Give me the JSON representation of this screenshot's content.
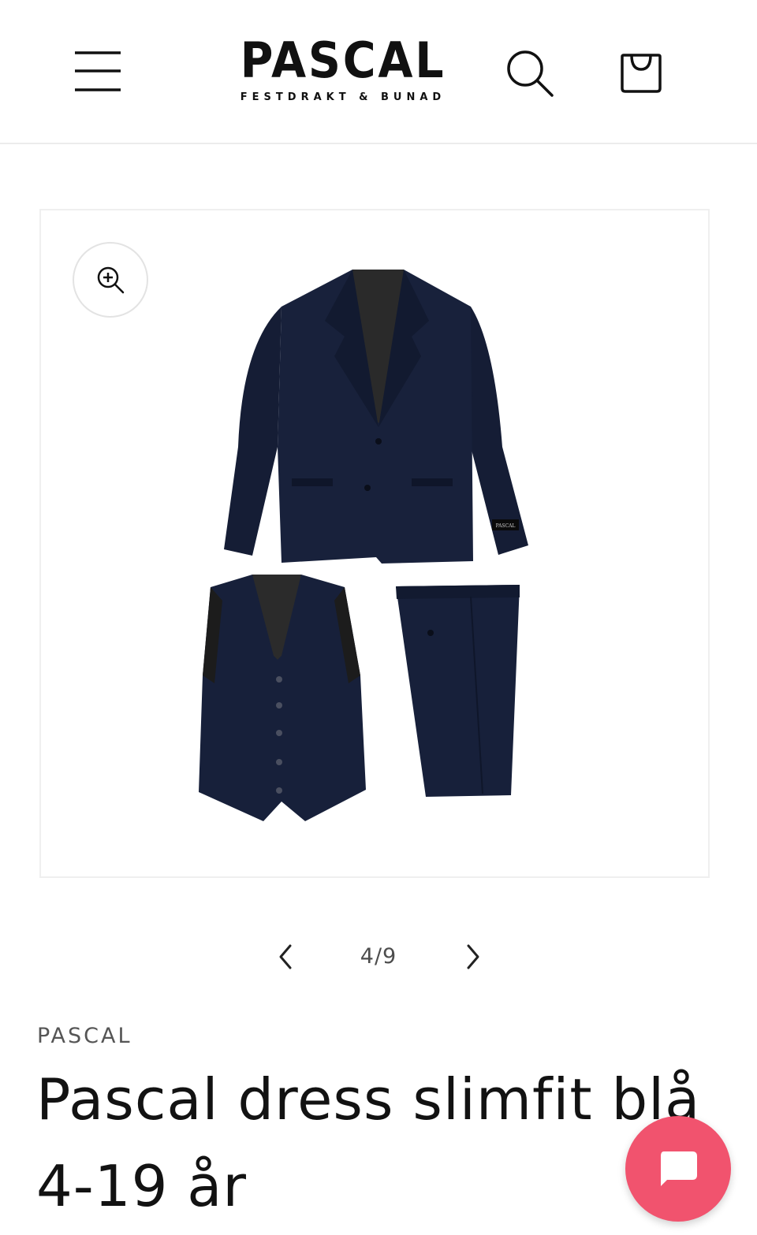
{
  "header": {
    "logo_main": "PASCAL",
    "logo_tagline": "FESTDRAKT & BUNAD",
    "menu_icon": "hamburger-menu-icon",
    "search_icon": "search-icon",
    "cart_icon": "shopping-bag-icon"
  },
  "gallery": {
    "zoom_icon": "zoom-in-icon",
    "image_alt": "Pascal dress slimfit blå – jakke, vest og bukse",
    "pager": {
      "prev_icon": "chevron-left-icon",
      "next_icon": "chevron-right-icon",
      "counter": "4/9"
    }
  },
  "product": {
    "vendor": "PASCAL",
    "title": "Pascal dress slimfit blå 4-19 år"
  },
  "chat": {
    "icon": "chat-bubble-icon",
    "color": "#f1536e"
  },
  "colors": {
    "suit_navy": "#141c33",
    "suit_lining": "#2b2b2b"
  }
}
